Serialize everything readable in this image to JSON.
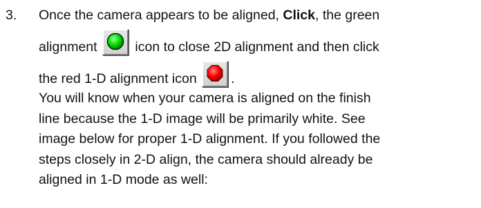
{
  "step": {
    "number": "3.",
    "line1_prefix": "Once the camera appears to be aligned, ",
    "line1_bold": "Click",
    "line1_suffix": ", the green",
    "line2_prefix": "alignment",
    "line2_suffix": "icon to close 2D alignment and then click",
    "line3_prefix": "the red 1-D alignment icon",
    "line3_suffix": ".",
    "green_icon": "green-circle-alignment-icon",
    "red_icon": "red-octagon-alignment-icon",
    "paragraph_lines": [
      "You will know when your camera is aligned on the finish",
      "line because the 1-D image will be primarily white. See",
      "image below for proper 1-D alignment.  If you followed the",
      "steps closely in 2-D align, the camera should already be",
      "aligned in 1-D mode as well:"
    ]
  },
  "colors": {
    "green_icon": "#00e000",
    "red_icon": "#ff0000",
    "text": "#111111"
  }
}
